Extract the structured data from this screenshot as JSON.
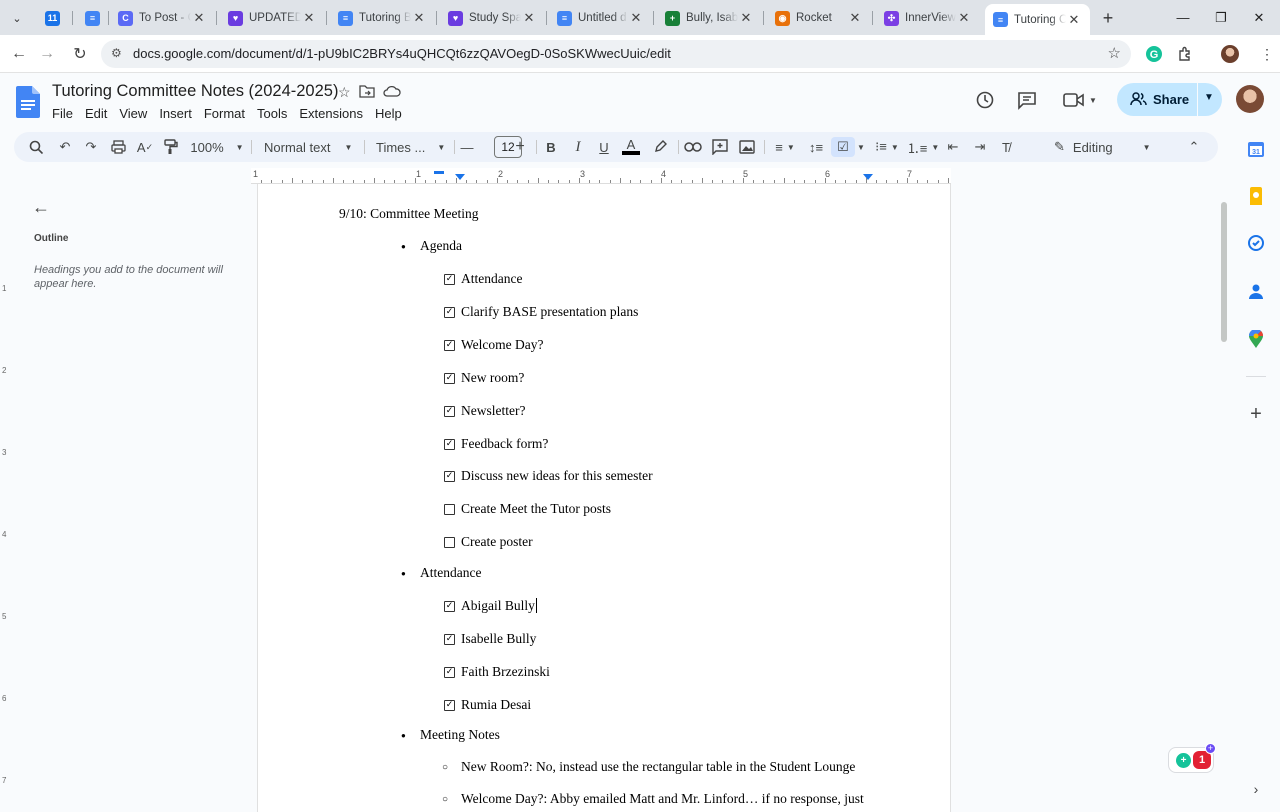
{
  "browser": {
    "tabs": [
      {
        "title": "",
        "color": "#1a73e8",
        "glyph": "11"
      },
      {
        "title": "",
        "color": "#4285f4",
        "glyph": "≡"
      },
      {
        "title": "To Post - C",
        "color": "#5b6af5",
        "glyph": "C"
      },
      {
        "title": "UPDATED",
        "color": "#6a3ce0",
        "glyph": "♥"
      },
      {
        "title": "Tutoring B",
        "color": "#4285f4",
        "glyph": "≡"
      },
      {
        "title": "Study Spac",
        "color": "#6a3ce0",
        "glyph": "♥"
      },
      {
        "title": "Untitled d",
        "color": "#4285f4",
        "glyph": "≡"
      },
      {
        "title": "Bully, Isab",
        "color": "#188038",
        "glyph": "+"
      },
      {
        "title": "Rocket",
        "color": "#e8710a",
        "glyph": "◉"
      },
      {
        "title": "InnerView",
        "color": "#7b3fe4",
        "glyph": "✣"
      },
      {
        "title": "Tutoring C",
        "color": "#4285f4",
        "glyph": "≡",
        "active": true
      }
    ],
    "url": "docs.google.com/document/d/1-pU9bIC2BRYs4uQHCQt6zzQAVOegD-0SoSKWwecUuic/edit"
  },
  "doc": {
    "title": "Tutoring Committee Notes (2024-2025)",
    "menu": [
      "File",
      "Edit",
      "View",
      "Insert",
      "Format",
      "Tools",
      "Extensions",
      "Help"
    ],
    "share_label": "Share"
  },
  "toolbar": {
    "zoom": "100%",
    "style": "Normal text",
    "font": "Times ...",
    "font_size": "12",
    "mode": "Editing"
  },
  "ruler": {
    "labels": [
      "1",
      "1",
      "2",
      "3",
      "4",
      "5",
      "6",
      "7"
    ],
    "v_labels": [
      "1",
      "2",
      "3",
      "4",
      "5",
      "6",
      "7"
    ]
  },
  "outline": {
    "title": "Outline",
    "hint": "Headings you add to the document will appear here."
  },
  "content": {
    "heading": "9/10: Committee Meeting",
    "agenda_label": "Agenda",
    "agenda": [
      {
        "text": "Attendance",
        "checked": true
      },
      {
        "text": "Clarify BASE presentation plans",
        "checked": true
      },
      {
        "text": "Welcome Day?",
        "checked": true
      },
      {
        "text": "New room?",
        "checked": true
      },
      {
        "text": "Newsletter?",
        "checked": true
      },
      {
        "text": "Feedback form?",
        "checked": true
      },
      {
        "text": "Discuss new ideas for this semester",
        "checked": true
      },
      {
        "text": "Create Meet the Tutor posts",
        "checked": false
      },
      {
        "text": "Create poster",
        "checked": false
      }
    ],
    "attendance_label": "Attendance",
    "attendance": [
      {
        "text": "Abigail Bully",
        "checked": true
      },
      {
        "text": "Isabelle Bully",
        "checked": true
      },
      {
        "text": "Faith Brzezinski",
        "checked": true
      },
      {
        "text": "Rumia Desai",
        "checked": true
      }
    ],
    "notes_label": "Meeting Notes",
    "notes": [
      "New Room?: No, instead use the rectangular table in the Student Lounge",
      "Welcome Day?: Abby emailed Matt and Mr. Linford… if no response, just"
    ]
  },
  "badge": {
    "count": "1"
  }
}
